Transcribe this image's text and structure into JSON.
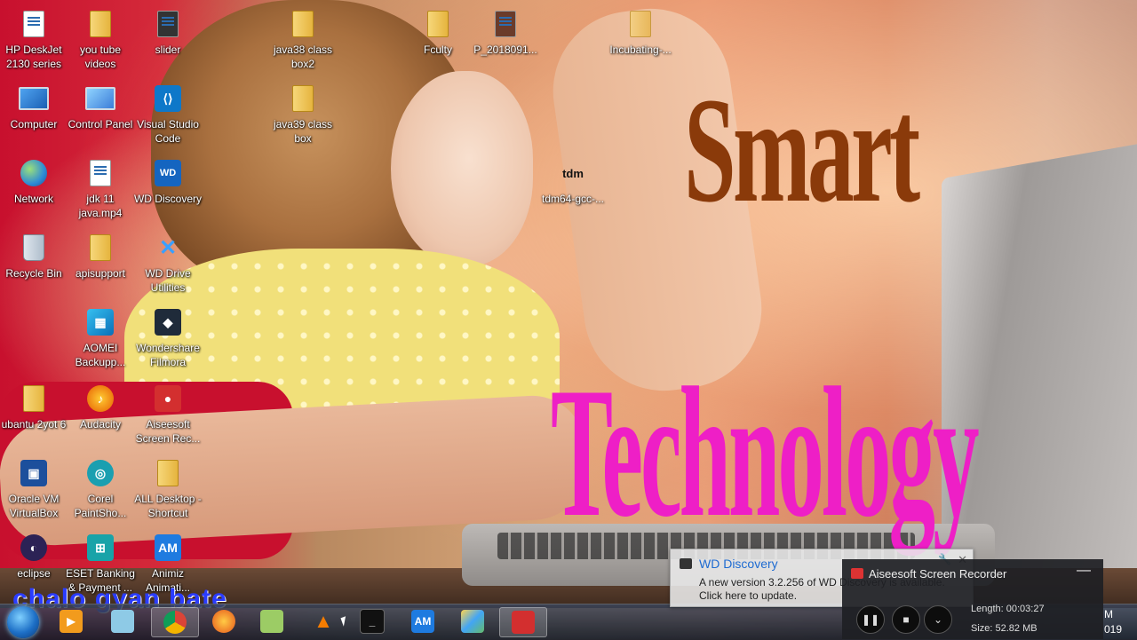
{
  "wallpaper": {
    "headline_top": "Smart",
    "headline_bottom": "Technology",
    "watermark": "chalo gyan bate"
  },
  "desktop_icons": [
    {
      "label": "HP DeskJet 2130 series",
      "icon": "printer-icon"
    },
    {
      "label": "you tube videos",
      "icon": "folder-icon"
    },
    {
      "label": "slider",
      "icon": "image-file-icon"
    },
    {
      "label": "java38 class box2",
      "icon": "folder-icon"
    },
    {
      "label": "Fculty",
      "icon": "folder-icon"
    },
    {
      "label": "P_2018091...",
      "icon": "photo-icon"
    },
    {
      "label": "Incubating-...",
      "icon": "folder-icon"
    },
    {
      "label": "Computer",
      "icon": "computer-icon"
    },
    {
      "label": "Control Panel",
      "icon": "control-panel-icon"
    },
    {
      "label": "Visual Studio Code",
      "icon": "vscode-icon"
    },
    {
      "label": "java39 class box",
      "icon": "folder-icon"
    },
    {
      "label": "Network",
      "icon": "network-icon"
    },
    {
      "label": "jdk 11 java.mp4",
      "icon": "video-file-icon"
    },
    {
      "label": "WD Discovery",
      "icon": "wd-icon"
    },
    {
      "label": "tdm64-gcc-...",
      "icon": "tdm-icon"
    },
    {
      "label": "Recycle Bin",
      "icon": "recycle-bin-icon"
    },
    {
      "label": "apisupport",
      "icon": "folder-icon"
    },
    {
      "label": "WD Drive Utilities",
      "icon": "tools-icon"
    },
    {
      "label": "AOMEI Backupp...",
      "icon": "aomei-icon"
    },
    {
      "label": "Wondershare Filmora",
      "icon": "filmora-icon"
    },
    {
      "label": "ubantu 2yot 6",
      "icon": "folder-icon"
    },
    {
      "label": "Audacity",
      "icon": "audacity-icon"
    },
    {
      "label": "Aiseesoft Screen Rec...",
      "icon": "recorder-icon"
    },
    {
      "label": "Oracle VM VirtualBox",
      "icon": "virtualbox-icon"
    },
    {
      "label": "Corel PaintSho...",
      "icon": "paintshop-icon"
    },
    {
      "label": "ALL Desktop - Shortcut",
      "icon": "shortcut-icon"
    },
    {
      "label": "eclipse",
      "icon": "eclipse-icon"
    },
    {
      "label": "ESET Banking & Payment ...",
      "icon": "eset-icon"
    },
    {
      "label": "Animiz Animati...",
      "icon": "animiz-icon"
    }
  ],
  "taskbar": {
    "items": [
      {
        "icon": "start-orb-icon",
        "label": ""
      },
      {
        "icon": "media-player-icon",
        "label": ""
      },
      {
        "icon": "notes-icon",
        "label": ""
      },
      {
        "icon": "chrome-icon",
        "label": ""
      },
      {
        "icon": "firefox-icon",
        "label": ""
      },
      {
        "icon": "notepad-plus-icon",
        "label": ""
      },
      {
        "icon": "vlc-icon",
        "label": ""
      },
      {
        "icon": "terminal-icon",
        "label": ""
      },
      {
        "icon": "animiz-icon",
        "label": "AM"
      },
      {
        "icon": "virtualbox-icon",
        "label": ""
      },
      {
        "icon": "recorder-icon",
        "label": ""
      }
    ],
    "clock_line1": "M",
    "clock_line2": "019"
  },
  "notification": {
    "title": "WD Discovery",
    "message": "A new version 3.2.256 of WD Discovery is available. Click here to update."
  },
  "recorder": {
    "title": "Aiseesoft Screen Recorder",
    "length_label": "Length: 00:03:27",
    "size_label": "Size: 52.82 MB",
    "minimize": "—",
    "pause_glyph": "❚❚",
    "stop_glyph": "■",
    "more_glyph": "⌄"
  },
  "colors": {
    "headline_top": "#8a3a0a",
    "headline_bottom": "#ee1fc6",
    "watermark": "#2a3cff",
    "notification_title": "#1e6bd1"
  }
}
